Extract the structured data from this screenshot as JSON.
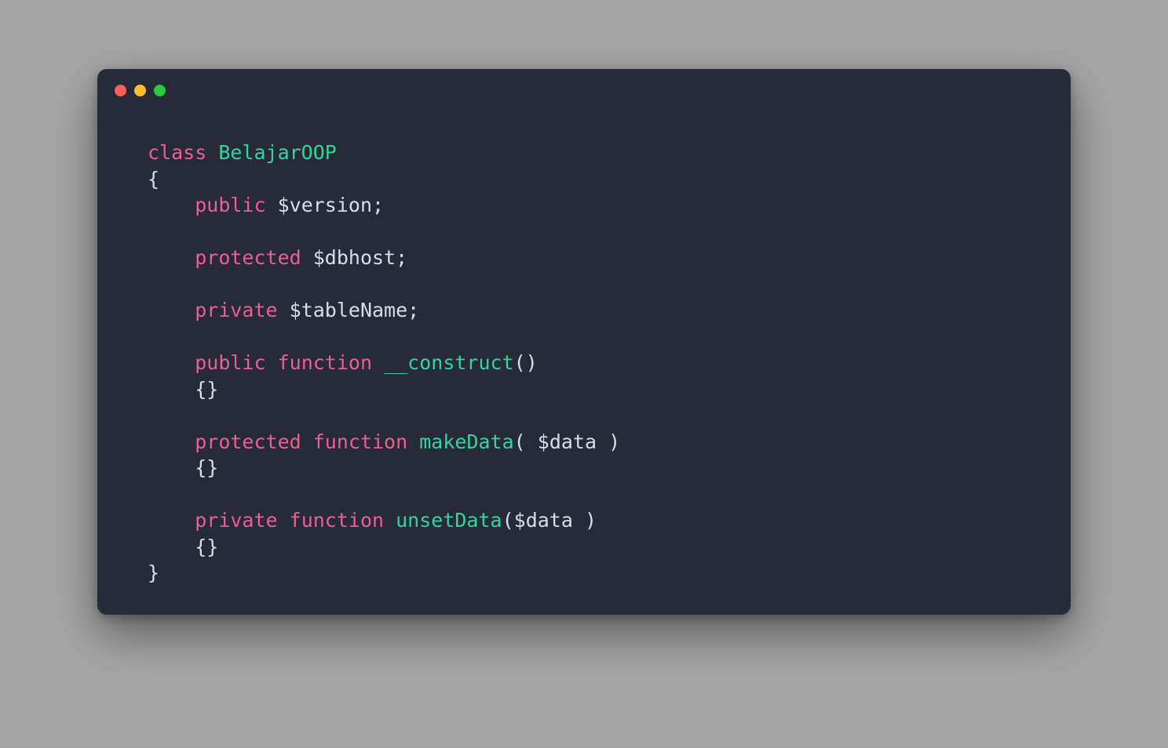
{
  "colors": {
    "bg": "#a6a6a6",
    "window": "#272b39",
    "keyword": "#ed5f92",
    "identifier": "#33d59a",
    "text": "#d9dde8",
    "dot_red": "#ff5f56",
    "dot_yellow": "#ffbd2e",
    "dot_green": "#27c93f"
  },
  "traffic_lights": [
    "red",
    "yellow",
    "green"
  ],
  "code": {
    "kw_class": "class",
    "class_name": "BelajarOOP",
    "brace_open": "{",
    "brace_close": "}",
    "braces_empty": "{}",
    "kw_public": "public",
    "kw_protected": "protected",
    "kw_private": "private",
    "kw_function": "function",
    "var_version": "$version",
    "var_dbhost": "$dbhost",
    "var_tableName": "$tableName",
    "var_data": "$data",
    "fn_construct": "__construct",
    "fn_makeData": "makeData",
    "fn_unsetData": "unsetData",
    "semicolon": ";",
    "paren_open": "(",
    "paren_close": ")",
    "space": " "
  }
}
